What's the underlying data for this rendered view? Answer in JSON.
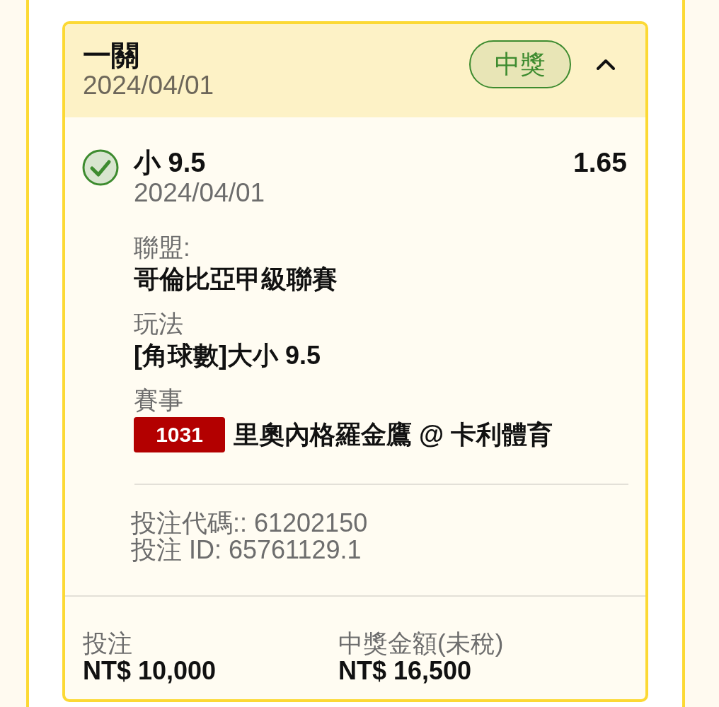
{
  "bet": {
    "title": "一關",
    "date": "2024/04/01",
    "status": {
      "label": "中獎",
      "kind": "won"
    },
    "expanded": true
  },
  "selection": {
    "won": true,
    "pick": "小 9.5",
    "odds": "1.65",
    "date": "2024/04/01",
    "details": [
      {
        "kind": "text",
        "label": "聯盟:",
        "value": "哥倫比亞甲級聯賽"
      },
      {
        "kind": "text",
        "label": "玩法",
        "value": "[角球數]大小 9.5"
      },
      {
        "kind": "event",
        "label": "賽事",
        "event_no": "1031",
        "value": "里奧內格羅金鷹 @ 卡利體育"
      }
    ],
    "references": [
      "投注代碼:: 61202150",
      "投注 ID: 65761129.1"
    ]
  },
  "summary": [
    {
      "label": "投注",
      "value": "NT$ 10,000"
    },
    {
      "label": "中獎金額(未稅)",
      "value": "NT$ 16,500"
    }
  ]
}
